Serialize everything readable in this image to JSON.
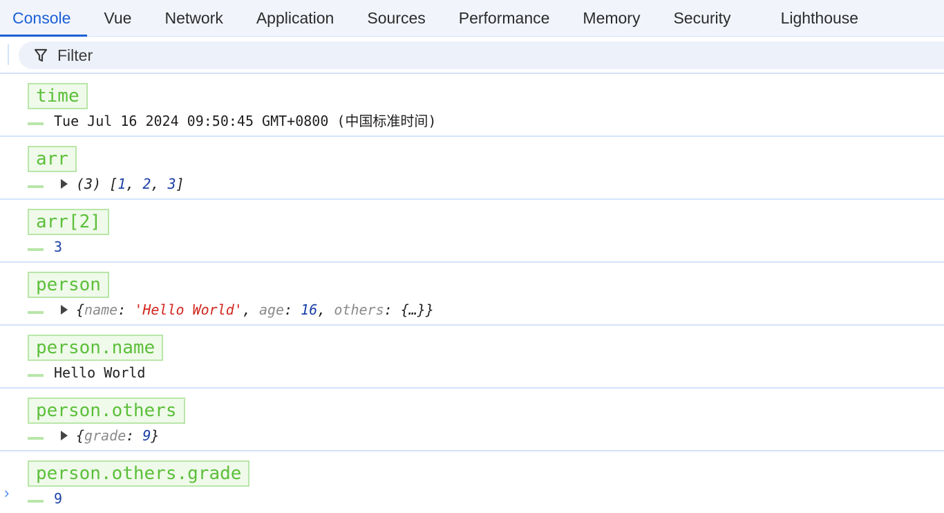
{
  "tabs": [
    "Console",
    "Vue",
    "Network",
    "Application",
    "Sources",
    "Performance",
    "Memory",
    "Security",
    "Lighthouse"
  ],
  "active_tab": "Console",
  "filter": {
    "placeholder": "Filter"
  },
  "entries": [
    {
      "label": "time",
      "value": "Tue Jul 16 2024 09:50:45 GMT+0800 (中国标准时间)"
    },
    {
      "label": "arr",
      "preview": {
        "count": "(3)",
        "items": [
          "1",
          "2",
          "3"
        ]
      }
    },
    {
      "label": "arr[2]",
      "value": "3"
    },
    {
      "label": "person",
      "preview": {
        "k1": "name",
        "v1": "'Hello World'",
        "k2": "age",
        "v2": "16",
        "k3": "others",
        "v3": "{…}"
      }
    },
    {
      "label": "person.name",
      "value": "Hello World"
    },
    {
      "label": "person.others",
      "preview": {
        "k1": "grade",
        "v1": "9"
      }
    },
    {
      "label": "person.others.grade",
      "value": "9"
    }
  ],
  "prompt": "›"
}
